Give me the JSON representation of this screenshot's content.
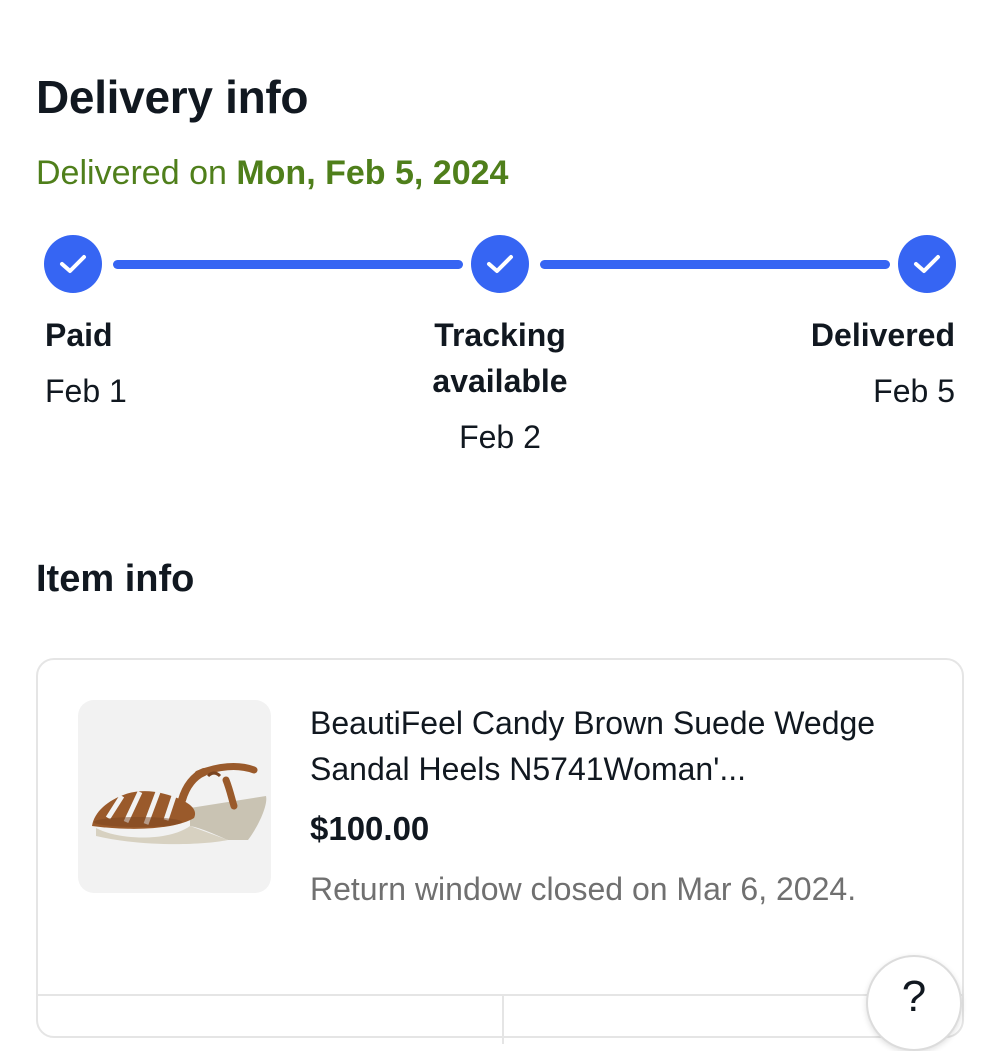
{
  "delivery": {
    "title": "Delivery info",
    "status_prefix": "Delivered on ",
    "status_date": "Mon, Feb 5, 2024",
    "status_color": "#4f7f1b"
  },
  "tracker": {
    "accent_color": "#3665f3",
    "steps": [
      {
        "label": "Paid",
        "date": "Feb 1",
        "completed": true,
        "icon": "check-icon"
      },
      {
        "label_line1": "Tracking",
        "label_line2": "available",
        "date": "Feb 2",
        "completed": true,
        "icon": "check-icon"
      },
      {
        "label": "Delivered",
        "date": "Feb 5",
        "completed": true,
        "icon": "check-icon"
      }
    ]
  },
  "item_section": {
    "title": "Item info",
    "item": {
      "title": "BeautiFeel Candy Brown Suede Wedge Sandal Heels N5741Woman'...",
      "price": "$100.00",
      "return_text": "Return window closed on Mar 6, 2024.",
      "image": "brown-suede-wedge-sandal"
    }
  },
  "help": {
    "label": "?",
    "icon": "help-icon"
  }
}
